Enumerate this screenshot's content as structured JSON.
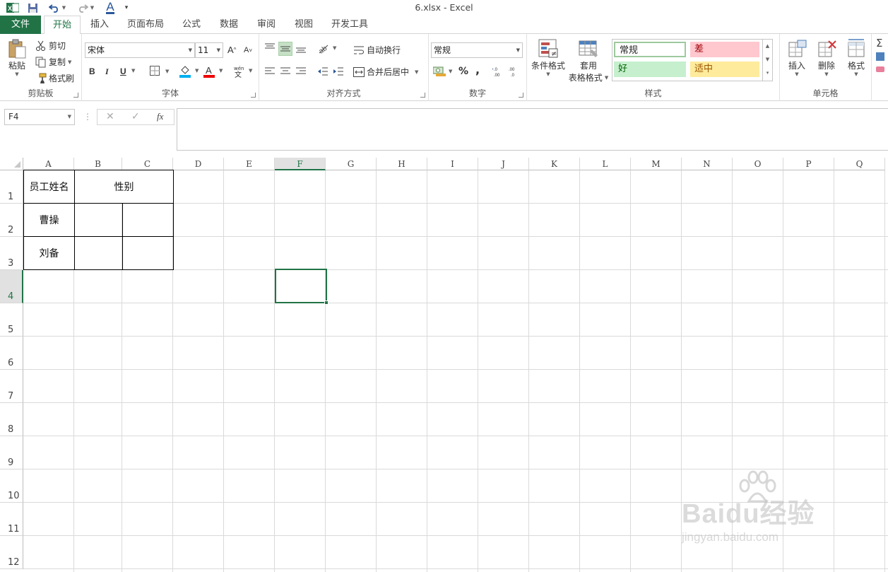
{
  "titlebar": {
    "title": "6.xlsx - Excel"
  },
  "tabs": [
    {
      "label": "文件"
    },
    {
      "label": "开始"
    },
    {
      "label": "插入"
    },
    {
      "label": "页面布局"
    },
    {
      "label": "公式"
    },
    {
      "label": "数据"
    },
    {
      "label": "审阅"
    },
    {
      "label": "视图"
    },
    {
      "label": "开发工具"
    }
  ],
  "ribbon": {
    "clipboard": {
      "paste": "粘贴",
      "cut": "剪切",
      "copy": "复制",
      "format_painter": "格式刷",
      "label": "剪贴板"
    },
    "font": {
      "name": "宋体",
      "size": "11",
      "bold": "B",
      "italic": "I",
      "underline": "U",
      "label": "字体"
    },
    "alignment": {
      "wrap": "自动换行",
      "merge": "合并后居中",
      "label": "对齐方式"
    },
    "number": {
      "format": "常规",
      "percent": "%",
      "comma": ",",
      "label": "数字"
    },
    "styles": {
      "conditional": "条件格式",
      "table_format_1": "套用",
      "table_format_2": "表格格式",
      "normal": "常规",
      "bad": "差",
      "good": "好",
      "neutral": "适中",
      "label": "样式"
    },
    "cells": {
      "insert": "插入",
      "delete": "删除",
      "format": "格式",
      "label": "单元格"
    }
  },
  "formula_bar": {
    "name_box": "F4",
    "fx": "fx",
    "cancel": "✕",
    "enter": "✓",
    "content": ""
  },
  "columns": [
    "A",
    "B",
    "C",
    "D",
    "E",
    "F",
    "G",
    "H",
    "I",
    "J",
    "K",
    "L",
    "M",
    "N",
    "O",
    "P",
    "Q"
  ],
  "rows": [
    "1",
    "2",
    "3",
    "4",
    "5",
    "6",
    "7",
    "8",
    "9",
    "10",
    "11",
    "12"
  ],
  "cells": {
    "A1": "员工姓名",
    "B1": "性别",
    "A2": "曹操",
    "A3": "刘备"
  },
  "selected_cell": "F4",
  "watermark": {
    "brand": "Baidu经验",
    "url": "jingyan.baidu.com"
  },
  "colors": {
    "accent": "#217346",
    "bad_bg": "#ffc7ce",
    "bad_fg": "#9c0006",
    "good_bg": "#c6efce",
    "good_fg": "#006100",
    "neutral_bg": "#ffeb9c",
    "neutral_fg": "#9c5700"
  }
}
